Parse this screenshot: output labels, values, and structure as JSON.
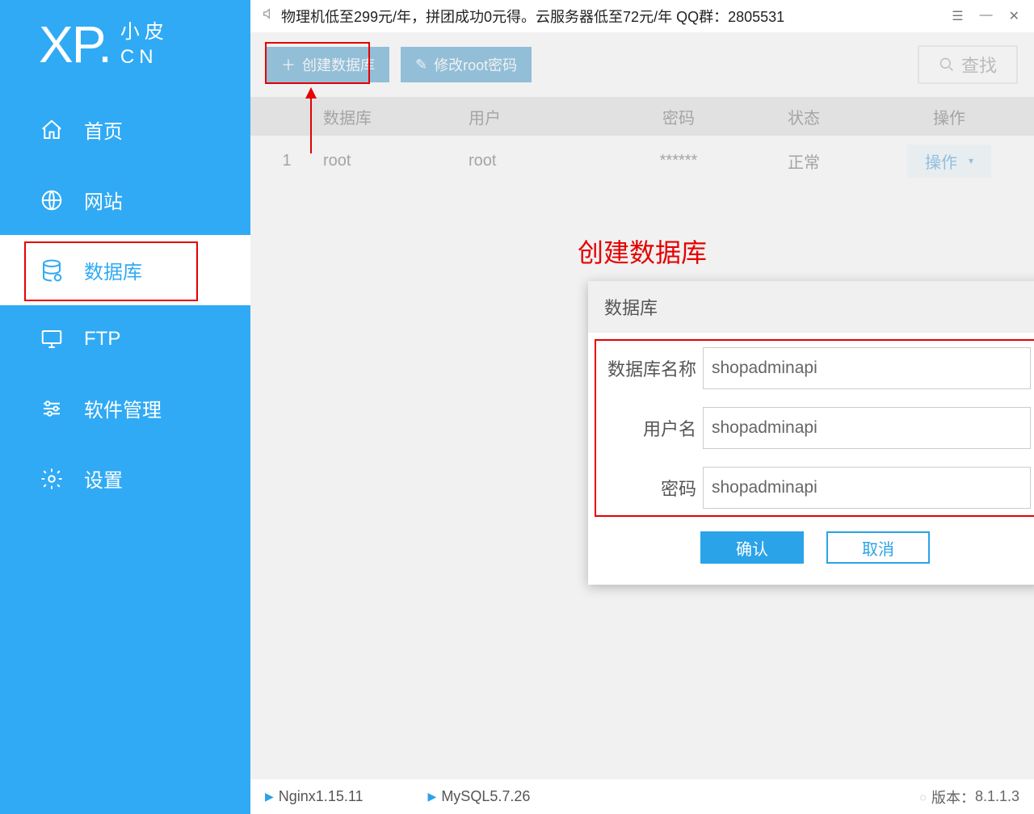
{
  "logo": {
    "xp": "XP.",
    "t1": "小皮",
    "t2": "CN"
  },
  "sidebar": {
    "items": [
      {
        "label": "首页"
      },
      {
        "label": "网站"
      },
      {
        "label": "数据库"
      },
      {
        "label": "FTP"
      },
      {
        "label": "软件管理"
      },
      {
        "label": "设置"
      }
    ]
  },
  "titlebar": {
    "text": "物理机低至299元/年，拼团成功0元得。云服务器低至72元/年  QQ群：2805531"
  },
  "toolbar": {
    "create_label": "创建数据库",
    "root_label": "修改root密码",
    "search_label": "查找"
  },
  "table": {
    "headers": {
      "db": "数据库",
      "user": "用户",
      "pwd": "密码",
      "state": "状态",
      "op": "操作"
    },
    "rows": [
      {
        "idx": "1",
        "db": "root",
        "user": "root",
        "pwd": "******",
        "state": "正常",
        "op": "操作"
      }
    ]
  },
  "annotation": {
    "title": "创建数据库"
  },
  "dialog": {
    "title": "数据库",
    "fields": {
      "dbname_label": "数据库名称",
      "dbname_value": "shopadminapi",
      "user_label": "用户名",
      "user_value": "shopadminapi",
      "pwd_label": "密码",
      "pwd_value": "shopadminapi"
    },
    "confirm": "确认",
    "cancel": "取消"
  },
  "statusbar": {
    "nginx": "Nginx1.15.11",
    "mysql": "MySQL5.7.26",
    "version_label": "版本：",
    "version": "8.1.1.3"
  }
}
